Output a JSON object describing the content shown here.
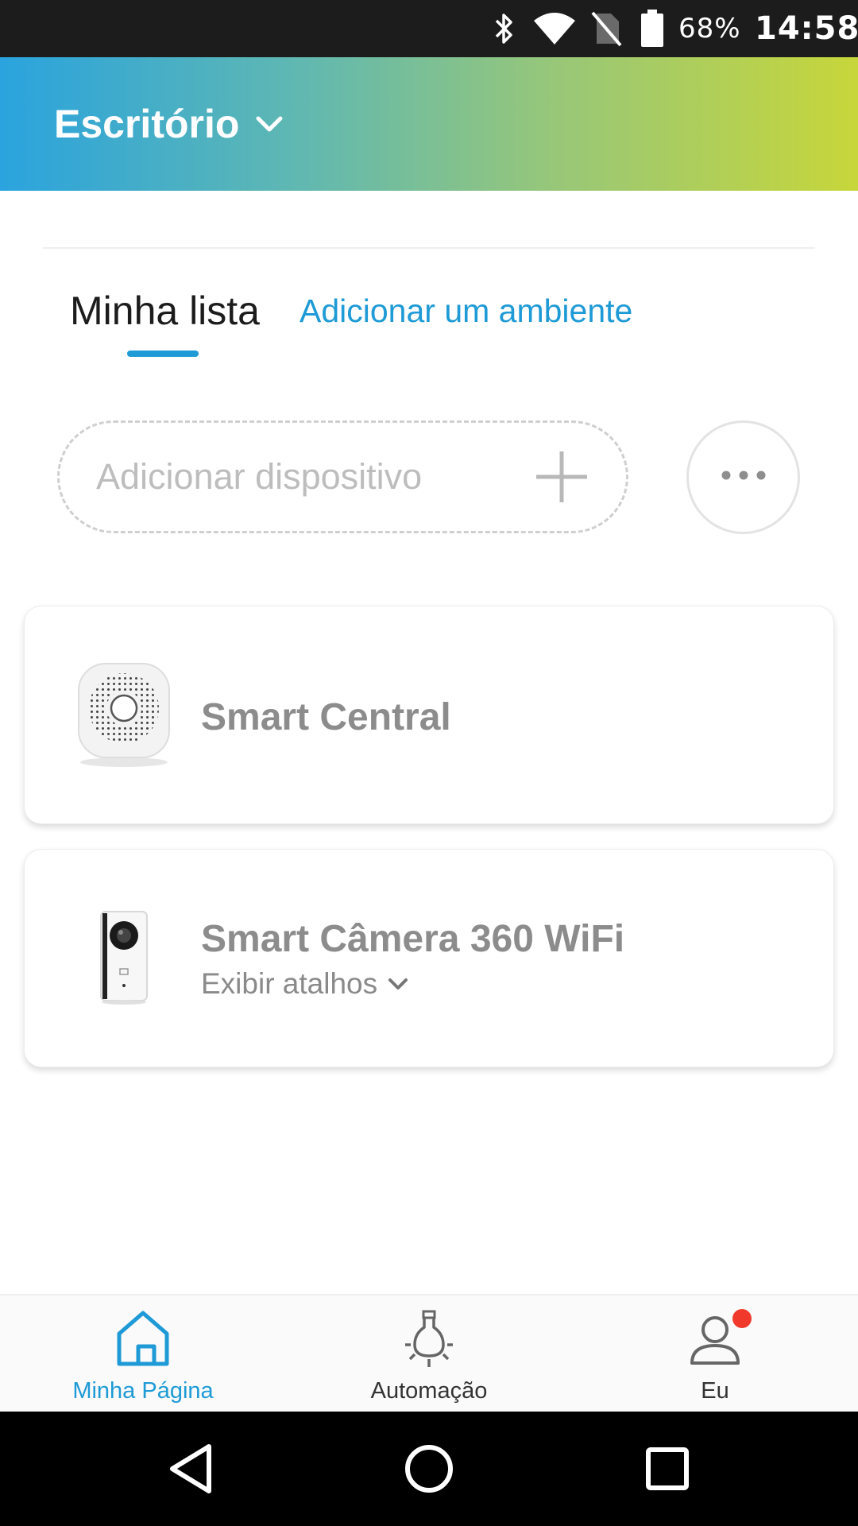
{
  "status_bar": {
    "battery_percent": "68%",
    "time": "14:58",
    "icons": [
      "bluetooth-icon",
      "wifi-icon",
      "no-sim-icon",
      "battery-icon"
    ]
  },
  "header": {
    "location": "Escritório",
    "dropdown_icon": "chevron-down-icon",
    "gradient": [
      "#2aa3de",
      "#c7d63a"
    ]
  },
  "tabs": [
    {
      "label": "Minha lista",
      "active": true
    },
    {
      "label": "Adicionar um ambiente",
      "active": false
    }
  ],
  "add_device": {
    "placeholder": "Adicionar dispositivo",
    "icon": "plus-icon",
    "more_icon": "more-horizontal-icon"
  },
  "devices": [
    {
      "name": "Smart Central",
      "image": "smart-central-device-image"
    },
    {
      "name": "Smart Câmera 360 WiFi",
      "subtitle": "Exibir atalhos",
      "image": "smart-camera-device-image"
    }
  ],
  "bottom_nav": [
    {
      "label": "Minha Página",
      "icon": "home-icon",
      "active": true
    },
    {
      "label": "Automação",
      "icon": "lightbulb-icon",
      "active": false
    },
    {
      "label": "Eu",
      "icon": "user-icon",
      "active": false,
      "badge": true
    }
  ],
  "colors": {
    "accent": "#1e9ad6",
    "badge": "#f0392b",
    "device_name": "#8c8c8c"
  }
}
